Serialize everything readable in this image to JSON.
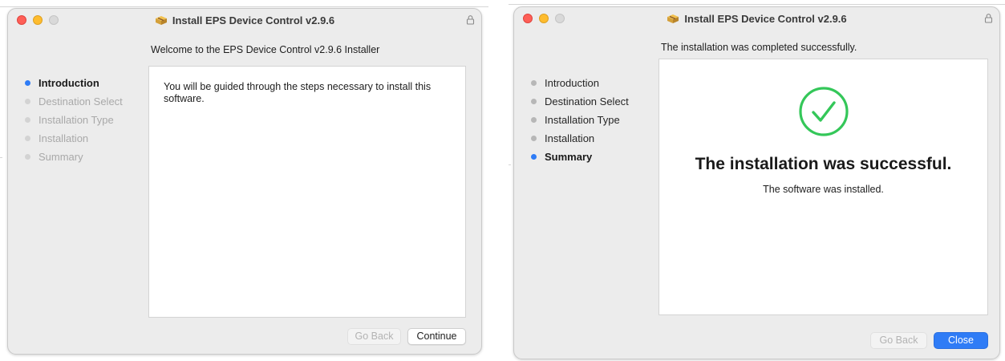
{
  "windows": [
    {
      "title": "Install EPS Device Control v2.9.6",
      "subtitle": "Welcome to the EPS Device Control v2.9.6 Installer",
      "steps": [
        {
          "label": "Introduction",
          "state": "current"
        },
        {
          "label": "Destination Select",
          "state": "future"
        },
        {
          "label": "Installation Type",
          "state": "future"
        },
        {
          "label": "Installation",
          "state": "future"
        },
        {
          "label": "Summary",
          "state": "future"
        }
      ],
      "body_text": "You will be guided through the steps necessary to install this software.",
      "buttons": {
        "back": "Go Back",
        "next": "Continue"
      }
    },
    {
      "title": "Install EPS Device Control v2.9.6",
      "subtitle": "The installation was completed successfully.",
      "steps": [
        {
          "label": "Introduction",
          "state": "done"
        },
        {
          "label": "Destination Select",
          "state": "done"
        },
        {
          "label": "Installation Type",
          "state": "done"
        },
        {
          "label": "Installation",
          "state": "done"
        },
        {
          "label": "Summary",
          "state": "current"
        }
      ],
      "success_title": "The installation was successful.",
      "success_subtitle": "The software was installed.",
      "buttons": {
        "back": "Go Back",
        "next": "Close"
      }
    }
  ],
  "icons": {
    "traffic_lights": [
      "close-button",
      "minimize-button",
      "zoom-button"
    ],
    "title_icon": "package-icon",
    "lock": "lock-icon",
    "success": "checkmark-circle-icon"
  },
  "colors": {
    "accent": "#2f7cf6",
    "success_green": "#34c759",
    "close_red": "#fe5f57",
    "minimize_yellow": "#febc2e"
  }
}
